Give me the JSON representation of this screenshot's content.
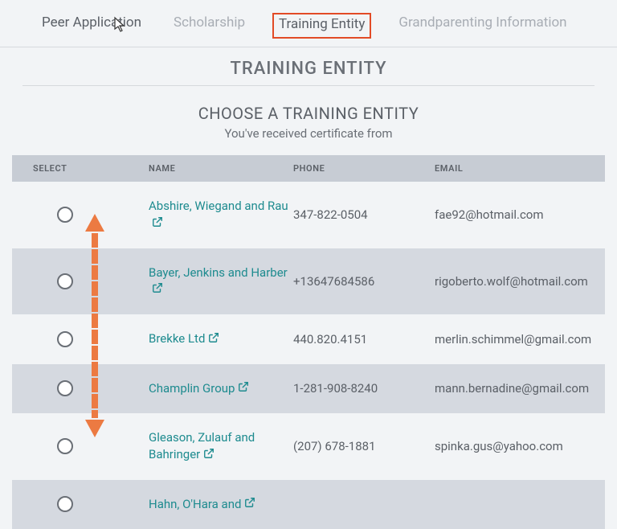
{
  "tabs": {
    "peer": "Peer Application",
    "scholarship": "Scholarship",
    "training": "Training Entity",
    "grandparenting": "Grandparenting Information"
  },
  "page_title": "TRAINING ENTITY",
  "choose_title": "CHOOSE A TRAINING ENTITY",
  "choose_sub": "You've received certificate from",
  "headers": {
    "select": "SELECT",
    "name": "NAME",
    "phone": "PHONE",
    "email": "EMAIL"
  },
  "rows": [
    {
      "name": "Abshire, Wiegand and Rau",
      "phone": "347-822-0504",
      "email": "fae92@hotmail.com"
    },
    {
      "name": "Bayer, Jenkins and Harber",
      "phone": "+13647684586",
      "email": "rigoberto.wolf@hotmail.com"
    },
    {
      "name": "Brekke Ltd",
      "phone": "440.820.4151",
      "email": "merlin.schimmel@gmail.com"
    },
    {
      "name": "Champlin Group",
      "phone": "1-281-908-8240",
      "email": "mann.bernadine@gmail.com"
    },
    {
      "name": "Gleason, Zulauf and Bahringer",
      "phone": "(207) 678-1881",
      "email": "spinka.gus@yahoo.com"
    },
    {
      "name": "Hahn, O'Hara and",
      "phone": "",
      "email": ""
    }
  ],
  "colors": {
    "link": "#1e8b8f",
    "highlight_border": "#e24b26",
    "arrow": "#ec7a42"
  }
}
